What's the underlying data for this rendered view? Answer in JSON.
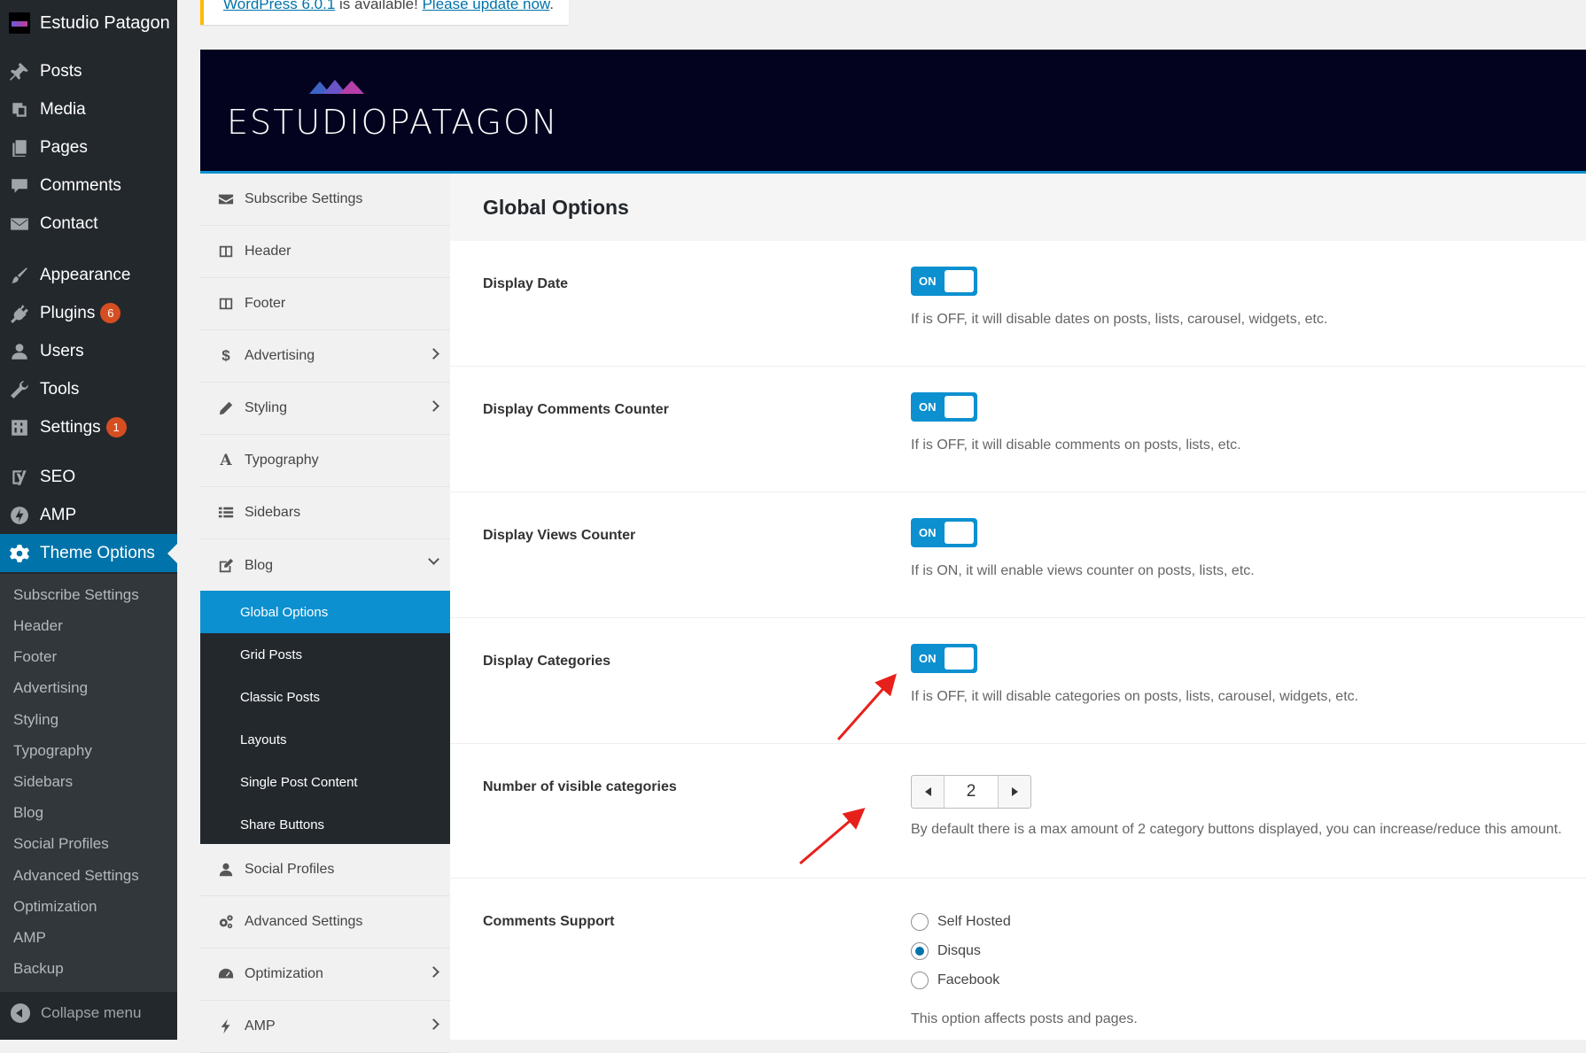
{
  "admin_menu": {
    "site_name": "Estudio Patagon",
    "items": [
      {
        "label": "Posts",
        "icon": "pin-icon"
      },
      {
        "label": "Media",
        "icon": "media-icon"
      },
      {
        "label": "Pages",
        "icon": "pages-icon"
      },
      {
        "label": "Comments",
        "icon": "comment-icon"
      },
      {
        "label": "Contact",
        "icon": "mail-icon"
      },
      {
        "label": "Appearance",
        "icon": "brush-icon"
      },
      {
        "label": "Plugins",
        "icon": "plug-icon",
        "badge": "6"
      },
      {
        "label": "Users",
        "icon": "user-icon"
      },
      {
        "label": "Tools",
        "icon": "wrench-icon"
      },
      {
        "label": "Settings",
        "icon": "settings-icon",
        "badge": "1"
      },
      {
        "label": "SEO",
        "icon": "yoast-icon"
      },
      {
        "label": "AMP",
        "icon": "amp-icon"
      },
      {
        "label": "Theme Options",
        "icon": "gear-icon"
      }
    ],
    "submenu": [
      "Subscribe Settings",
      "Header",
      "Footer",
      "Advertising",
      "Styling",
      "Typography",
      "Sidebars",
      "Blog",
      "Social Profiles",
      "Advanced Settings",
      "Optimization",
      "AMP",
      "Backup"
    ],
    "collapse_label": "Collapse menu"
  },
  "notice": {
    "link1": "WordPress 6.0.1",
    "text": " is available! ",
    "link2": "Please update now",
    "end": "."
  },
  "brand": {
    "name": "ESTUDIOPATAGON"
  },
  "options_nav": {
    "items": [
      {
        "label": "Subscribe Settings",
        "icon": "envelope-icon"
      },
      {
        "label": "Header",
        "icon": "columns-icon"
      },
      {
        "label": "Footer",
        "icon": "columns-icon"
      },
      {
        "label": "Advertising",
        "icon": "dollar-icon",
        "chevron": true
      },
      {
        "label": "Styling",
        "icon": "pencil-icon",
        "chevron": true
      },
      {
        "label": "Typography",
        "icon": "font-icon"
      },
      {
        "label": "Sidebars",
        "icon": "list-icon"
      },
      {
        "label": "Blog",
        "icon": "edit-icon",
        "chevron": "down"
      }
    ],
    "blog_sub": [
      "Global Options",
      "Grid Posts",
      "Classic Posts",
      "Layouts",
      "Single Post Content",
      "Share Buttons"
    ],
    "after": [
      {
        "label": "Social Profiles",
        "icon": "user-icon"
      },
      {
        "label": "Advanced Settings",
        "icon": "cogs-icon"
      },
      {
        "label": "Optimization",
        "icon": "dashboard-icon",
        "chevron": true
      },
      {
        "label": "AMP",
        "icon": "bolt-icon",
        "chevron": true
      }
    ]
  },
  "content": {
    "title": "Global Options",
    "toggle_label": "ON",
    "rows": [
      {
        "label": "Display Date",
        "desc": "If is OFF, it will disable dates on posts, lists, carousel, widgets, etc."
      },
      {
        "label": "Display Comments Counter",
        "desc": "If is OFF, it will disable comments on posts, lists, etc."
      },
      {
        "label": "Display Views Counter",
        "desc": "If is ON, it will enable views counter on posts, lists, etc."
      },
      {
        "label": "Display Categories",
        "desc": "If is OFF, it will disable categories on posts, lists, carousel, widgets, etc."
      }
    ],
    "visible_categories": {
      "label": "Number of visible categories",
      "value": "2",
      "desc": "By default there is a max amount of 2 category buttons displayed, you can increase/reduce this amount."
    },
    "comments_support": {
      "label": "Comments Support",
      "options": [
        "Self Hosted",
        "Disqus",
        "Facebook"
      ],
      "selected": "Disqus",
      "desc": "This option affects posts and pages."
    }
  },
  "colors": {
    "accent": "#0c90d0",
    "wp_active": "#0073aa",
    "menu_bg": "#23282d",
    "header_bg": "#03031f",
    "annotation": "#e8201b"
  }
}
